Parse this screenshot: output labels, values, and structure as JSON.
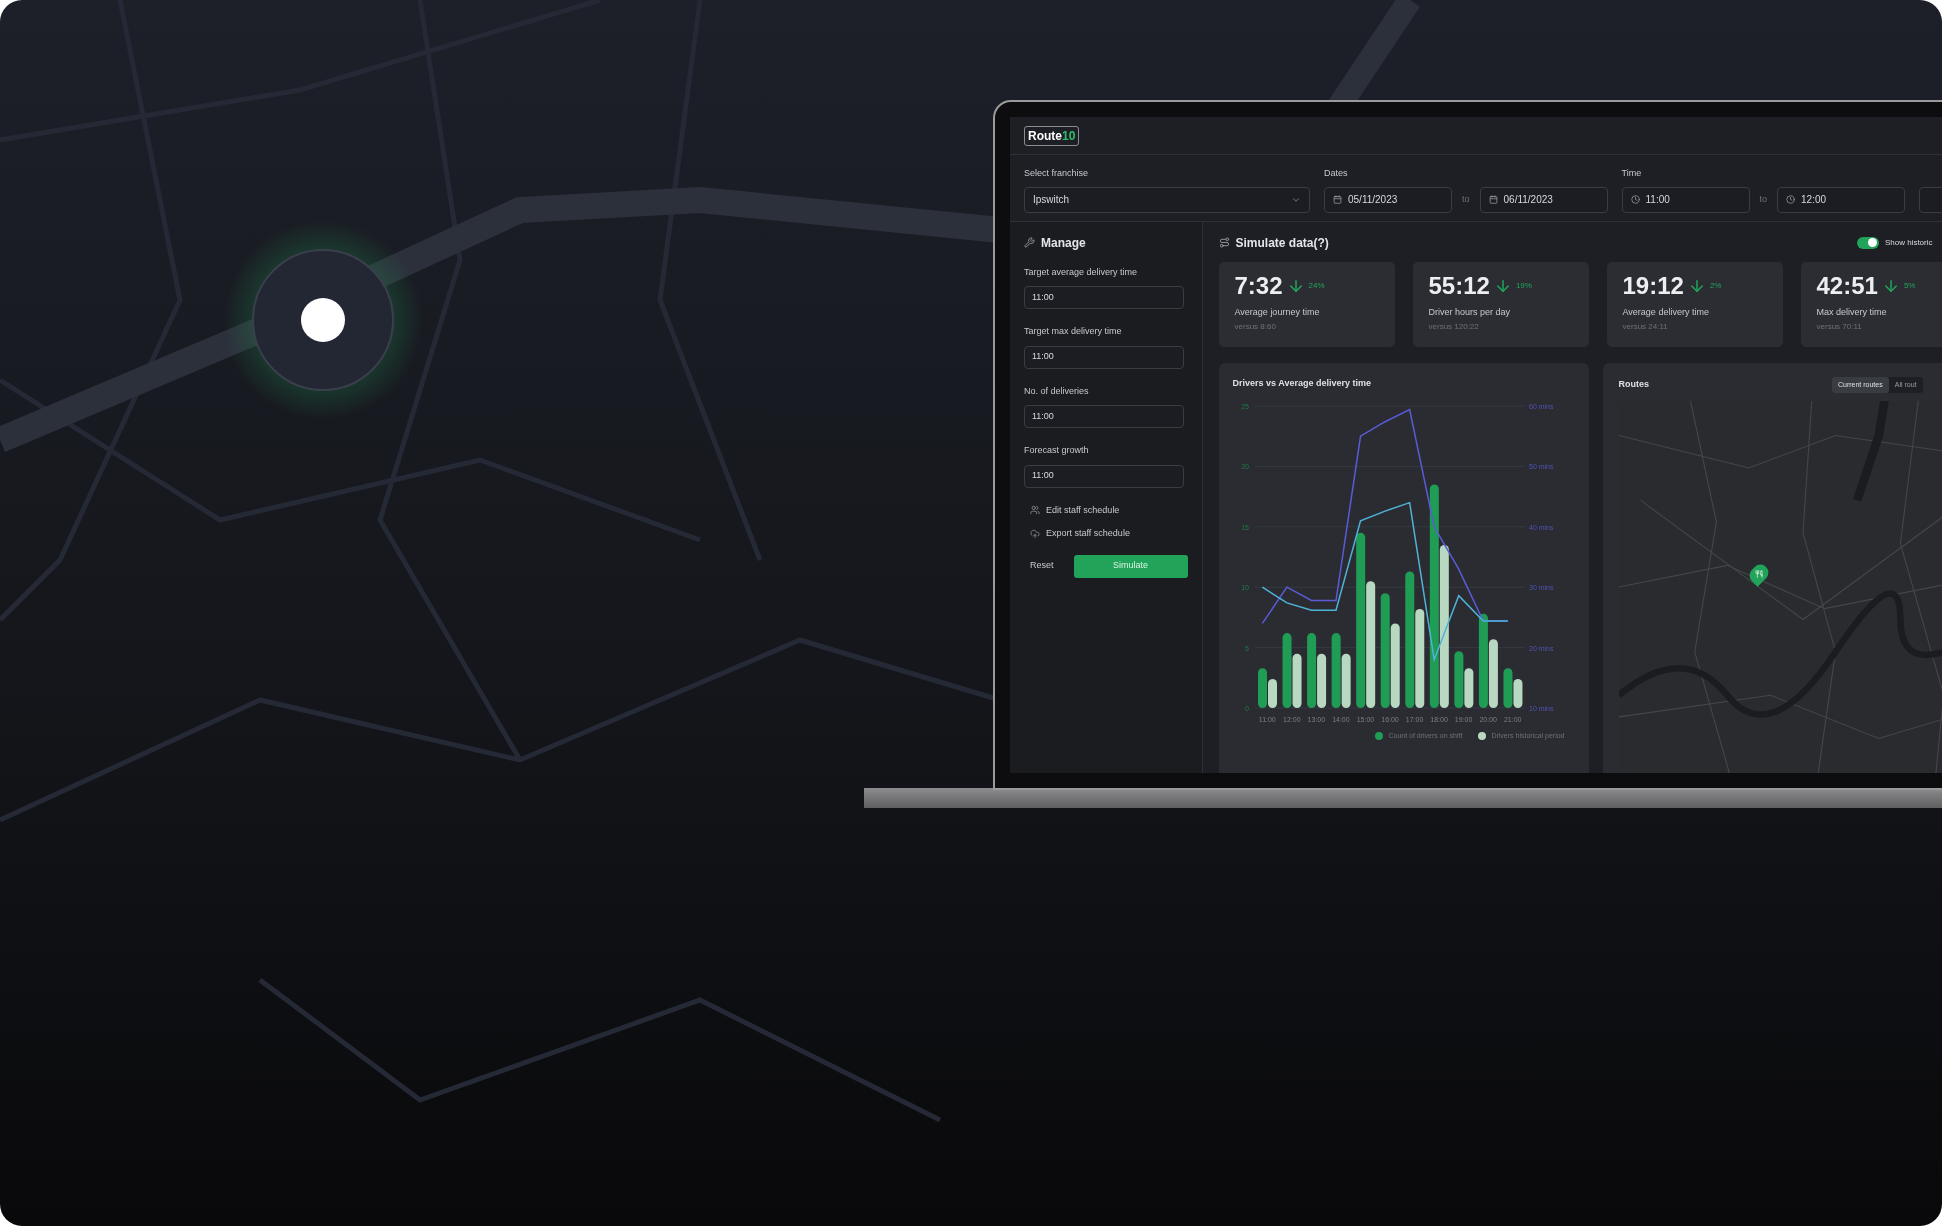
{
  "app": {
    "logo_text": "Route",
    "logo_accent": "10"
  },
  "filters": {
    "franchise": {
      "label": "Select franchise",
      "value": "Ipswitch"
    },
    "dates": {
      "label": "Dates",
      "from": "05/11/2023",
      "separator": "to",
      "to": "06/11/2023"
    },
    "time": {
      "label": "Time",
      "from": "11:00",
      "separator": "to",
      "to": "12:00"
    }
  },
  "manage": {
    "title": "Manage",
    "fields": [
      {
        "label": "Target average delivery time",
        "value": "11:00"
      },
      {
        "label": "Target max delivery time",
        "value": "11:00"
      },
      {
        "label": "No. of deliveries",
        "value": "11:00"
      },
      {
        "label": "Forecast growth",
        "value": "11:00"
      }
    ],
    "actions": [
      {
        "kind": "edit",
        "label": "Edit staff schedule"
      },
      {
        "kind": "export",
        "label": "Export staff schedule"
      }
    ],
    "reset": "Reset",
    "simulate": "Simulate"
  },
  "simulate": {
    "title": "Simulate data(?)",
    "toggle": {
      "label": "Show historic",
      "on": true
    }
  },
  "kpis": [
    {
      "value": "7:32",
      "change": "24%",
      "label": "Average journey time",
      "comparison": "versus 8:60"
    },
    {
      "value": "55:12",
      "change": "19%",
      "label": "Driver hours per day",
      "comparison": "versus 120:22"
    },
    {
      "value": "19:12",
      "change": "2%",
      "label": "Average delivery time",
      "comparison": "versus 24:11"
    },
    {
      "value": "42:51",
      "change": "5%",
      "label": "Max delivery time",
      "comparison": "versus 70:11"
    }
  ],
  "chart": {
    "chart_data": {
      "type": "bar",
      "title": "Drivers vs Average delivery time",
      "categories": [
        "11:00",
        "12:00",
        "13:00",
        "14:00",
        "15:00",
        "16:00",
        "17:00",
        "18:00",
        "19:00",
        "20:00",
        "21:00"
      ],
      "series": [
        {
          "name": "Count of drivers on shift",
          "color": "#1f9d55",
          "values": [
            3.3,
            6.2,
            6.2,
            6.2,
            14.5,
            9.5,
            11.3,
            18.5,
            4.7,
            7.8,
            3.3
          ]
        },
        {
          "name": "Drivers historical period",
          "color": "#b8d8c2",
          "values": [
            2.4,
            4.5,
            4.5,
            4.5,
            10.5,
            7,
            8.2,
            13.5,
            3.3,
            5.7,
            2.4
          ]
        },
        {
          "type": "line",
          "axis": "y2",
          "color": "#5b5bd6",
          "values": [
            24,
            30,
            27.8,
            27.8,
            55,
            57.4,
            59.4,
            40,
            33,
            24.4,
            24.4
          ]
        },
        {
          "type": "line",
          "axis": "y2",
          "color": "#4fb3d9",
          "values": [
            30,
            27.4,
            26.2,
            26.2,
            41,
            42.6,
            44,
            18,
            28.6,
            24.4,
            24.4
          ]
        }
      ],
      "grid": true,
      "ylim": [
        0,
        25
      ],
      "yticks": [
        0,
        5,
        10,
        15,
        20,
        25
      ],
      "y2lim": [
        10,
        60
      ],
      "y2ticks": [
        {
          "value": 10,
          "label": "10 mins"
        },
        {
          "value": 20,
          "label": "20 mins"
        },
        {
          "value": 30,
          "label": "30 mins"
        },
        {
          "value": 40,
          "label": "40 mins"
        },
        {
          "value": 50,
          "label": "50 mins"
        },
        {
          "value": 60,
          "label": "60 mins"
        }
      ]
    }
  },
  "routes": {
    "title": "Routes",
    "tabs": [
      {
        "label": "Current routes",
        "selected": true
      },
      {
        "label": "All rout",
        "selected": false
      }
    ]
  }
}
